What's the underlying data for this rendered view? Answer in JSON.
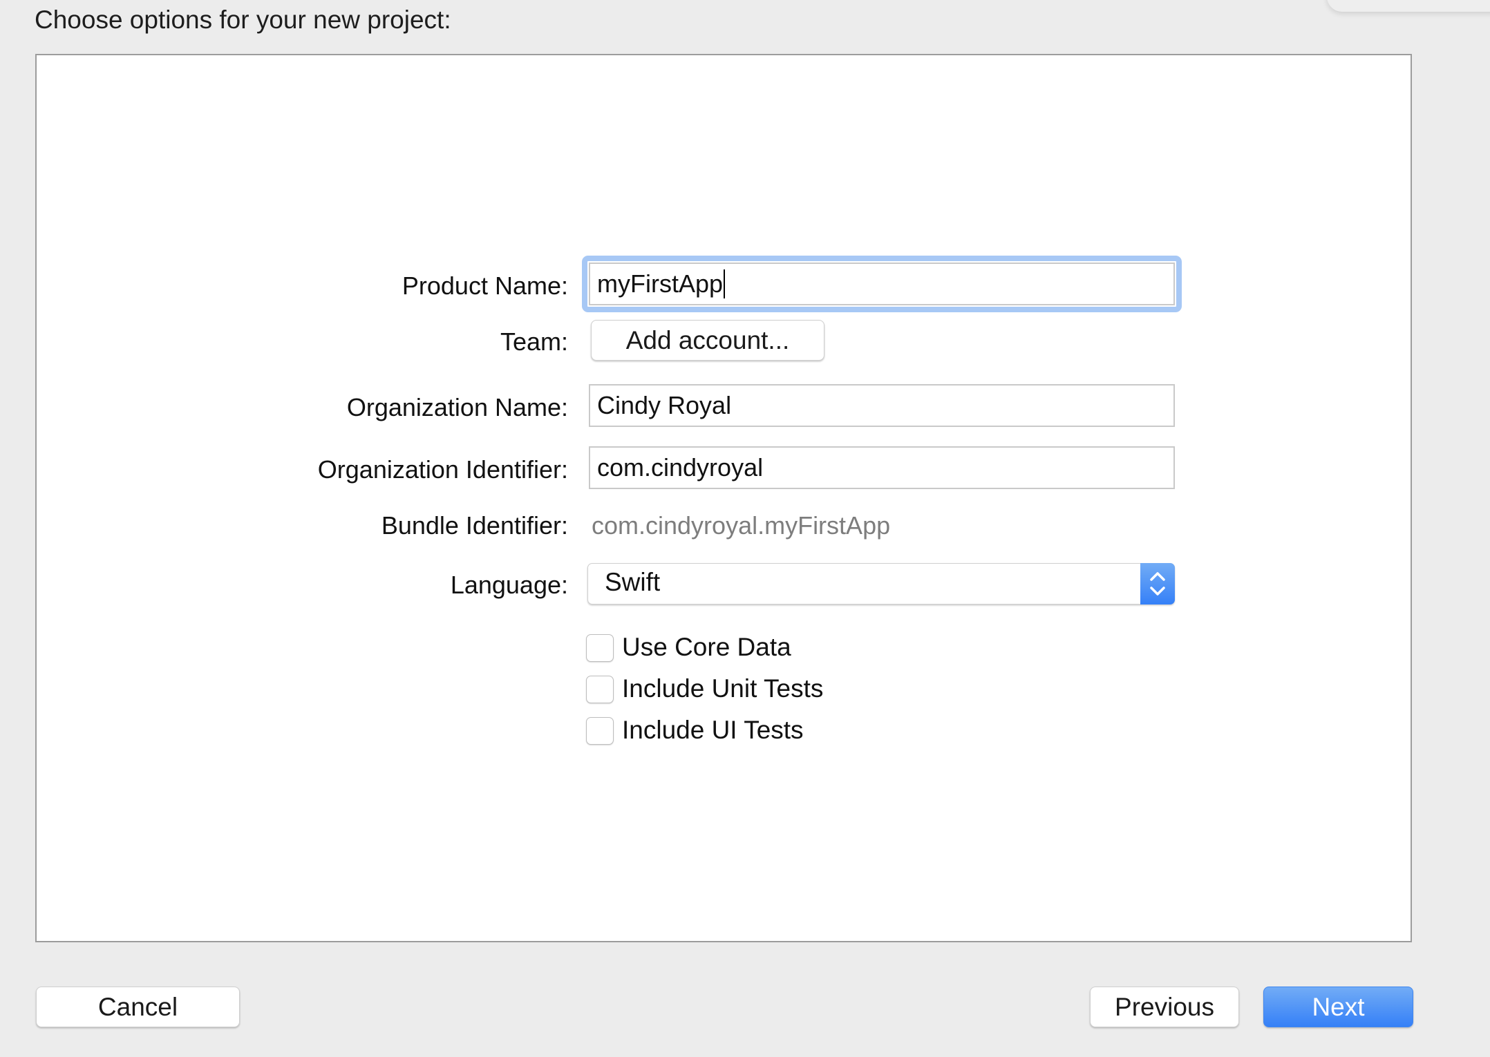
{
  "dialog": {
    "title": "Choose options for your new project:"
  },
  "form": {
    "product_name": {
      "label": "Product Name:",
      "value": "myFirstApp",
      "focused": true
    },
    "team": {
      "label": "Team:",
      "button_label": "Add account..."
    },
    "organization_name": {
      "label": "Organization Name:",
      "value": "Cindy Royal"
    },
    "organization_identifier": {
      "label": "Organization Identifier:",
      "value": "com.cindyroyal"
    },
    "bundle_identifier": {
      "label": "Bundle Identifier:",
      "value": "com.cindyroyal.myFirstApp"
    },
    "language": {
      "label": "Language:",
      "selected": "Swift"
    },
    "checkboxes": [
      {
        "label": "Use Core Data",
        "checked": false
      },
      {
        "label": "Include Unit Tests",
        "checked": false
      },
      {
        "label": "Include UI Tests",
        "checked": false
      }
    ]
  },
  "buttons": {
    "cancel": "Cancel",
    "previous": "Previous",
    "next": "Next"
  },
  "colors": {
    "accent": "#3580f7",
    "focus_ring": "#a7c8f5",
    "window_background": "#ececec"
  }
}
